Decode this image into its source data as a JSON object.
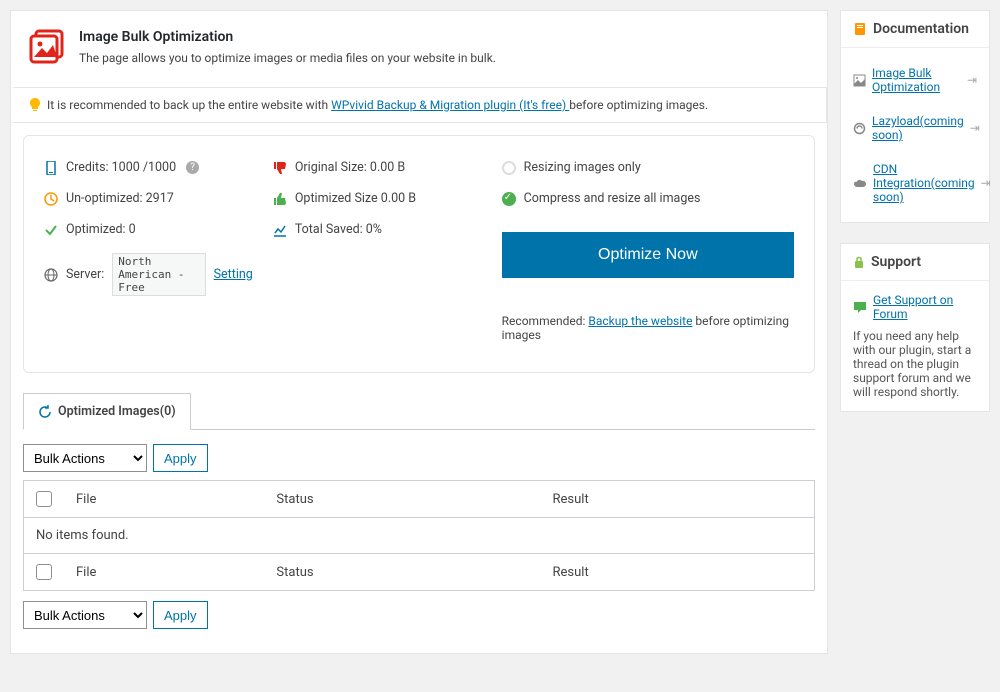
{
  "header": {
    "title": "Image Bulk Optimization",
    "description": "The page allows you to optimize images or media files on your website in bulk."
  },
  "notice": {
    "text_before": "It is recommended to back up the entire website with ",
    "link": "WPvivid Backup & Migration plugin (It's free) ",
    "text_after": "before optimizing images."
  },
  "stats": {
    "credits": "Credits: 1000 /1000",
    "unoptimized": "Un-optimized: 2917",
    "optimized": "Optimized: 0",
    "server_label": "Server:",
    "server_value": "North American - Free",
    "server_setting": "Setting",
    "original_size": "Original Size: 0.00 B",
    "optimized_size": "Optimized Size 0.00 B",
    "total_saved": "Total Saved: 0%",
    "option_resize": "Resizing images only",
    "option_compress": "Compress and resize all images",
    "optimize_btn": "Optimize Now",
    "recommended_before": "Recommended: ",
    "recommended_link": "Backup the website",
    "recommended_after": " before optimizing images"
  },
  "tabs": {
    "optimized": "Optimized Images(0)"
  },
  "bulk": {
    "select": "Bulk Actions",
    "apply": "Apply"
  },
  "table": {
    "col_file": "File",
    "col_status": "Status",
    "col_result": "Result",
    "empty": "No items found."
  },
  "sidebar": {
    "doc_head": "Documentation",
    "doc_items": [
      {
        "label": "Image Bulk Optimization"
      },
      {
        "label": "Lazyload(coming soon)"
      },
      {
        "label": "CDN Integration(coming soon)"
      }
    ],
    "support_head": "Support",
    "support_link": "Get Support on Forum",
    "support_text": "If you need any help with our plugin, start a thread on the plugin support forum and we will respond shortly."
  }
}
